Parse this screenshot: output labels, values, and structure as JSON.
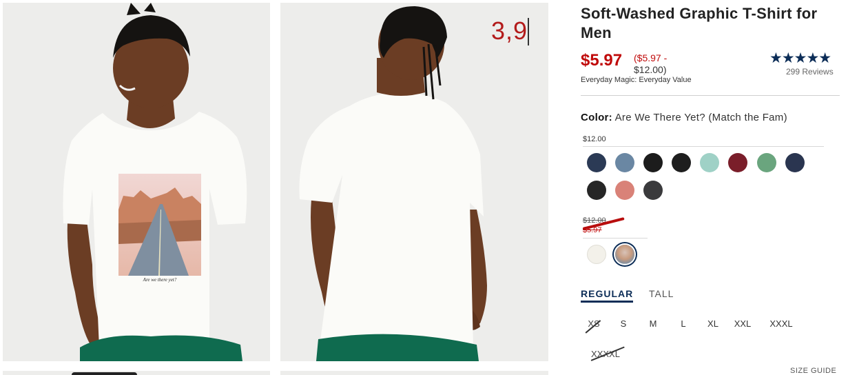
{
  "photo_counter": "3,9",
  "shirt_print_caption": "Are we there yet?",
  "product": {
    "title": "Soft-Washed Graphic T-Shirt for Men",
    "price": "$5.97",
    "price_range_low": "($5.97 -",
    "price_range_high": "$12.00)",
    "badge": "Everyday Magic: Everyday Value",
    "stars": "★★★★★",
    "reviews": "299 Reviews"
  },
  "color": {
    "label": "Color:",
    "value": "Are We There Yet? (Match the Fam)"
  },
  "group1": {
    "price": "$12.00",
    "swatches": [
      {
        "name": "navy",
        "color": "#2b3a55"
      },
      {
        "name": "slate-blue",
        "color": "#6a87a3"
      },
      {
        "name": "black",
        "color": "#1c1c1c"
      },
      {
        "name": "black-2",
        "color": "#1e1e1e"
      },
      {
        "name": "aqua",
        "color": "#9fd1c6"
      },
      {
        "name": "burgundy",
        "color": "#7a1e2a"
      },
      {
        "name": "green",
        "color": "#6aa57e"
      },
      {
        "name": "dark-navy",
        "color": "#2a3550"
      },
      {
        "name": "charcoal",
        "color": "#262626"
      },
      {
        "name": "coral",
        "color": "#d98278"
      },
      {
        "name": "dark-gray",
        "color": "#3a3a3c"
      }
    ]
  },
  "group2": {
    "original_price": "$12.00",
    "sale_price": "$5.97",
    "swatches": [
      {
        "name": "white",
        "color": "#f3f1ea"
      },
      {
        "name": "are-we-there-yet",
        "color": "#c9a58a"
      }
    ]
  },
  "fit_tabs": [
    "REGULAR",
    "TALL"
  ],
  "sizes": [
    "XS",
    "S",
    "M",
    "L",
    "XL",
    "XXL",
    "XXXL",
    "XXXXL"
  ],
  "size_guide": "SIZE GUIDE"
}
